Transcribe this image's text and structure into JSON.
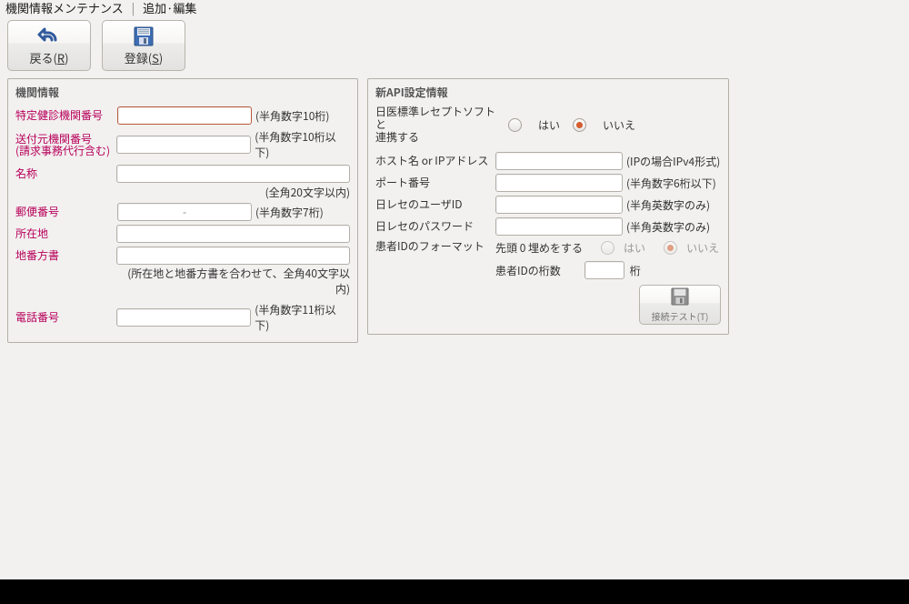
{
  "title": {
    "main": "機関情報メンテナンス",
    "sep": "|",
    "sub": "追加·編集"
  },
  "toolbar": {
    "back_label": "戻る(R)",
    "reg_label": "登録(S)"
  },
  "left": {
    "panel_title": "機関情報",
    "inst_no_label": "特定健診機関番号",
    "inst_no_hint": "(半角数字10桁)",
    "sender_label_a": "送付元機関番号",
    "sender_label_b": "(請求事務代行含む)",
    "sender_hint": "(半角数字10桁以下)",
    "name_label": "名称",
    "name_hint": "(全角20文字以内)",
    "zip_label": "郵便番号",
    "zip_dash": "-",
    "zip_hint": "(半角数字7桁)",
    "addr_label": "所在地",
    "chiban_label": "地番方書",
    "addr_hint": "(所在地と地番方書を合わせて、全角40文字以内)",
    "tel_label": "電話番号",
    "tel_hint": "(半角数字11桁以下)"
  },
  "right": {
    "panel_title": "新API設定情報",
    "link_label_a": "日医標準レセプトソフトと",
    "link_label_b": "連携する",
    "link_yes": "はい",
    "link_no": "いいえ",
    "host_label": "ホスト名 or IPアドレス",
    "host_hint": "(IPの場合IPv4形式)",
    "port_label": "ポート番号",
    "port_hint": "(半角数字6桁以下)",
    "user_label": "日レセのユーザID",
    "user_hint": "(半角英数字のみ)",
    "pass_label": "日レセのパスワード",
    "pass_hint": "(半角英数字のみ)",
    "pid_label": "患者IDのフォーマット",
    "pid_pad_label": "先頭 0 埋めをする",
    "pid_yes": "はい",
    "pid_no": "いいえ",
    "pid_len_label": "患者IDの桁数",
    "pid_len_unit": "桁",
    "conn_test": "接続テスト(T)"
  }
}
